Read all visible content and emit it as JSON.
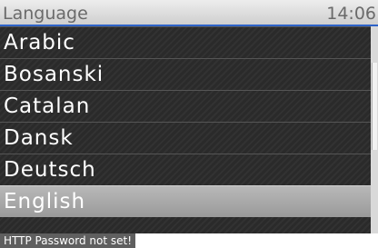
{
  "header": {
    "title": "Language",
    "clock": "14:06"
  },
  "languages": {
    "items": [
      {
        "label": "Arabic"
      },
      {
        "label": "Bosanski"
      },
      {
        "label": "Catalan"
      },
      {
        "label": "Dansk"
      },
      {
        "label": "Deutsch"
      },
      {
        "label": "English",
        "selected": true
      }
    ]
  },
  "status": {
    "message": "HTTP Password not set!"
  },
  "colors": {
    "accent": "#2e63c8",
    "list_background": "#2a2a2a",
    "selected_row": "#a8a8a8",
    "status_background": "#5f5f5f"
  }
}
